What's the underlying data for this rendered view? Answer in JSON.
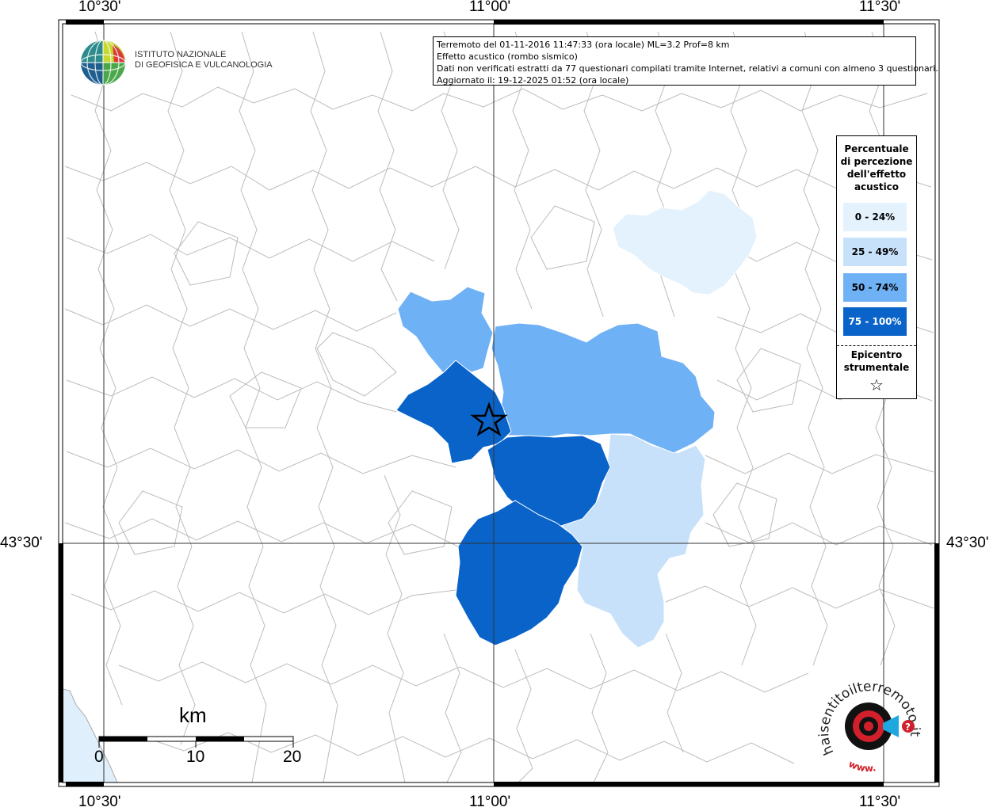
{
  "map": {
    "top_lon_labels": [
      "10°30'",
      "11°00'",
      "11°30'"
    ],
    "bottom_lon_labels": [
      "10°30'",
      "11°00'",
      "11°30'"
    ],
    "left_lat_label": "43°30'",
    "right_lat_label": "43°30'",
    "epicenter_icon": "star-icon",
    "colors": {
      "class_0_24": "#e3f2fd",
      "class_25_49": "#c8e1fa",
      "class_50_74": "#6eb1f5",
      "class_75_100": "#0963c9",
      "sea": "#dff0fc",
      "boundary": "#bcbcbc"
    }
  },
  "info": {
    "line1": "Terremoto del 01-11-2016 11:47:33 (ora locale) ML=3.2 Prof=8 km",
    "line2": "Effetto acustico (rombo sismico)",
    "line3": "Dati non verificati estratti da 77 questionari compilati tramite Internet, relativi a comuni con almeno 3 questionari.",
    "line4": "Aggiornato il: 19-12-2025 01:52 (ora locale)"
  },
  "logo_ingv": {
    "line1": "ISTITUTO NAZIONALE",
    "line2": "DI GEOFISICA E VULCANOLOGIA"
  },
  "legend": {
    "title": [
      "Percentuale",
      "di percezione",
      "dell'effetto",
      "acustico"
    ],
    "items": [
      {
        "label": "0 - 24%",
        "color": "#e3f2fd",
        "text_color": "#000000"
      },
      {
        "label": "25 - 49%",
        "color": "#c8e1fa",
        "text_color": "#000000"
      },
      {
        "label": "50 - 74%",
        "color": "#6eb1f5",
        "text_color": "#000000"
      },
      {
        "label": "75 - 100%",
        "color": "#0963c9",
        "text_color": "#ffffff"
      }
    ],
    "epicenter": [
      "Epicentro",
      "strumentale"
    ],
    "epicenter_symbol": "☆"
  },
  "scale": {
    "unit": "km",
    "labels": [
      "0",
      "10",
      "20"
    ]
  },
  "logo_hsit": {
    "text": "haisentitoilterremoto.it",
    "url_prefix": "www."
  }
}
